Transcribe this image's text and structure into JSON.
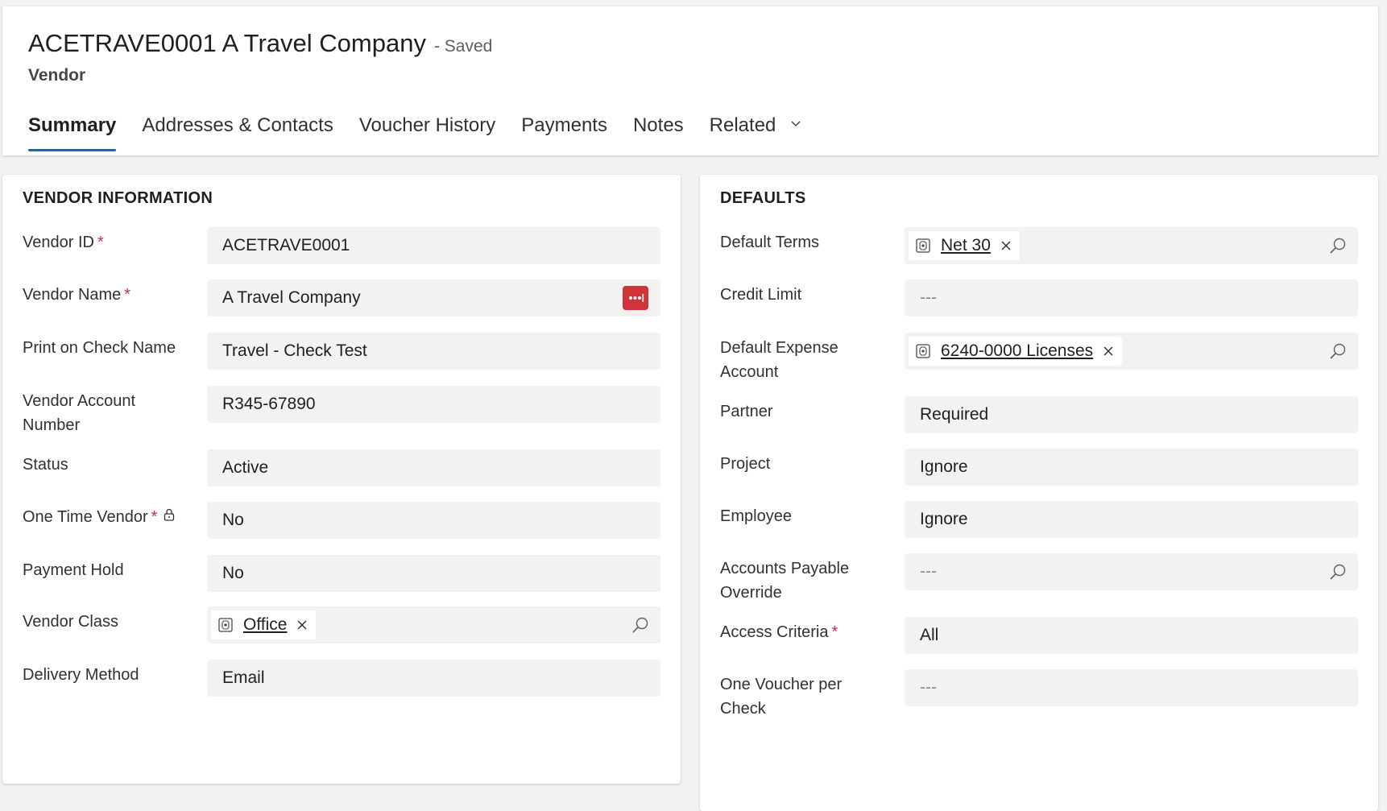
{
  "header": {
    "title": "ACETRAVE0001 A Travel Company",
    "status": "- Saved",
    "entity": "Vendor",
    "tabs": [
      {
        "label": "Summary"
      },
      {
        "label": "Addresses & Contacts"
      },
      {
        "label": "Voucher History"
      },
      {
        "label": "Payments"
      },
      {
        "label": "Notes"
      },
      {
        "label": "Related"
      }
    ]
  },
  "vendor_info": {
    "title": "VENDOR INFORMATION",
    "required_mark": "*",
    "fields": [
      {
        "label": "Vendor ID",
        "value": "ACETRAVE0001"
      },
      {
        "label": "Vendor Name",
        "value": "A Travel Company"
      },
      {
        "label": "Print on Check Name",
        "value": "Travel - Check Test"
      },
      {
        "label": "Vendor Account Number",
        "value": "R345-67890"
      },
      {
        "label": "Status",
        "value": "Active"
      },
      {
        "label": "One Time Vendor",
        "value": "No"
      },
      {
        "label": "Payment Hold",
        "value": "No"
      },
      {
        "label": "Vendor Class",
        "value": "Office"
      },
      {
        "label": "Delivery Method",
        "value": "Email"
      }
    ]
  },
  "defaults": {
    "title": "DEFAULTS",
    "fields": [
      {
        "label": "Default Terms",
        "value": "Net 30"
      },
      {
        "label": "Credit Limit",
        "value": "---"
      },
      {
        "label": "Default Expense Account",
        "value": "6240-0000 Licenses"
      },
      {
        "label": "Partner",
        "value": "Required"
      },
      {
        "label": "Project",
        "value": "Ignore"
      },
      {
        "label": "Employee",
        "value": "Ignore"
      },
      {
        "label": "Accounts Payable Override",
        "value": "---"
      },
      {
        "label": "Access Criteria",
        "value": "All"
      },
      {
        "label": "One Voucher per Check",
        "value": "---"
      }
    ]
  },
  "colors": {
    "accent": "#0f6cbd",
    "required": "#c4314b",
    "password_icon": "#d13438"
  },
  "icons": {
    "lookup": "search-icon",
    "remove": "close-icon",
    "entity": "entity-record-icon",
    "lock": "lock-icon",
    "password": "password-manager-icon"
  }
}
